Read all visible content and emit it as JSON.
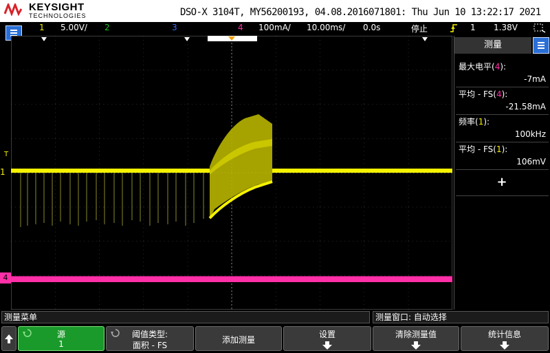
{
  "header": {
    "brand": "KEYSIGHT",
    "brand_sub": "TECHNOLOGIES",
    "model_line": "DSO-X 3104T, MY56200193, 04.08.2016071801: Thu Jun 10 13:22:17 2021"
  },
  "status_bar": {
    "ch1_num": "1",
    "ch1_scale": "5.00V/",
    "ch2_num": "2",
    "ch3_num": "3",
    "ch4_num": "4",
    "ch4_scale": "100mA/",
    "timebase": "10.00ms/",
    "delay": "0.0s",
    "run_state": "停止",
    "trigger_source": "1",
    "trigger_level": "1.38V"
  },
  "colors": {
    "ch1": "#f5f200",
    "ch2": "#22c022",
    "ch3": "#3b6cff",
    "ch4": "#ff2fa8",
    "menu_button": "#2a6fd6",
    "softkey_active": "#1a9a2a"
  },
  "markers": {
    "trigger_marker": "T",
    "ch1_marker": "1",
    "ch4_marker": "4"
  },
  "measurement_panel": {
    "title": "测量",
    "items": [
      {
        "label_pre": "最大电平(",
        "ch": "4",
        "label_post": "):",
        "value": "-7mA"
      },
      {
        "label_pre": "平均 - FS(",
        "ch": "4",
        "label_post": "):",
        "value": "-21.58mA"
      },
      {
        "label_pre": "频率(",
        "ch": "1",
        "label_post": "):",
        "value": "100kHz"
      },
      {
        "label_pre": "平均 - FS(",
        "ch": "1",
        "label_post": "):",
        "value": "106mV"
      }
    ],
    "add_symbol": "+"
  },
  "softkeys": {
    "menu_title": "测量菜单",
    "window_label": "测量窗口: 自动选择",
    "source_label": "源",
    "source_value": "1",
    "threshold_label": "阈值类型:",
    "threshold_value": "面积 - FS",
    "add_measure": "添加测量",
    "settings": "设置",
    "clear": "清除测量值",
    "stats": "统计信息"
  }
}
